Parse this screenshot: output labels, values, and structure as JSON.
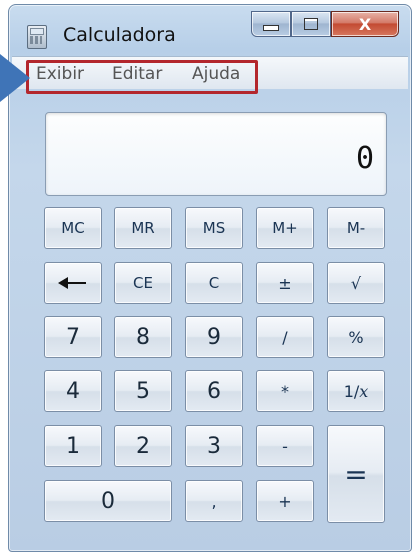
{
  "window": {
    "title": "Calculadora",
    "close_label": "X",
    "frame_color": "#b9cde4",
    "accent_highlight": "#b3272d",
    "pointer_color": "#3f74b7"
  },
  "menu": {
    "items": [
      {
        "label": "Exibir"
      },
      {
        "label": "Editar"
      },
      {
        "label": "Ajuda"
      }
    ]
  },
  "display": {
    "value": "0"
  },
  "keys": {
    "mc": "MC",
    "mr": "MR",
    "ms": "MS",
    "mplus": "M+",
    "mminus": "M-",
    "ce": "CE",
    "c": "C",
    "plusminus": "±",
    "sqrt": "√",
    "n7": "7",
    "n8": "8",
    "n9": "9",
    "divide": "/",
    "percent": "%",
    "n4": "4",
    "n5": "5",
    "n6": "6",
    "multiply": "*",
    "reciprocal_prefix": "1/",
    "reciprocal_var": "x",
    "n1": "1",
    "n2": "2",
    "n3": "3",
    "minus": "-",
    "equals": "=",
    "n0": "0",
    "decimal": ",",
    "plus": "+"
  },
  "icons": {
    "app": "calculator-icon",
    "backspace": "backspace-arrow-icon",
    "minimize": "minimize-icon",
    "maximize": "maximize-icon",
    "close": "close-icon"
  }
}
